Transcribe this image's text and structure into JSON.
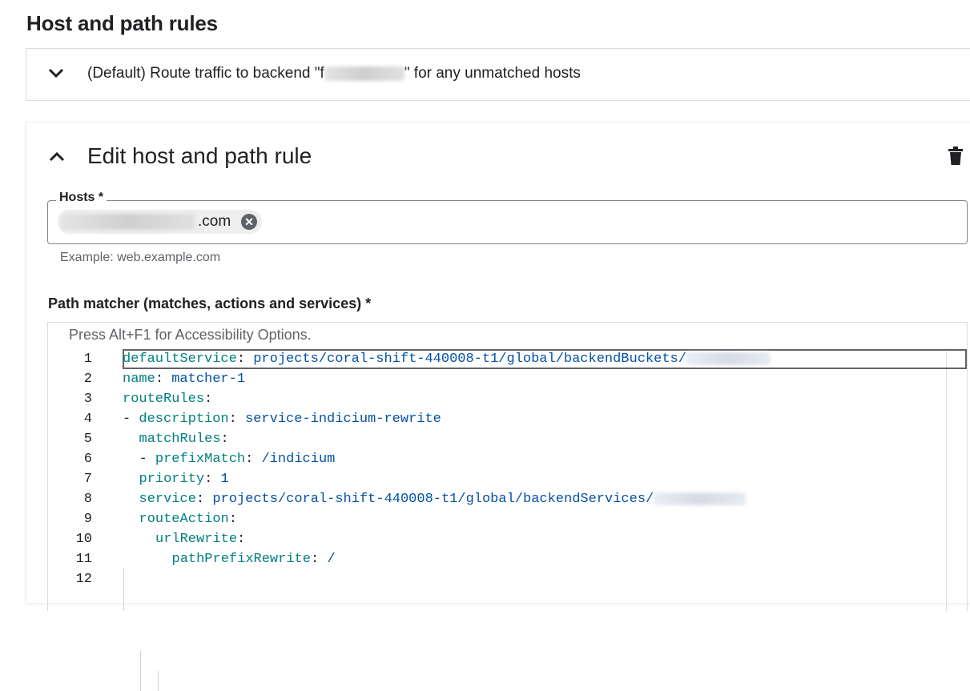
{
  "page": {
    "title": "Host and path rules"
  },
  "default_rule": {
    "text_before": "(Default) Route traffic to backend \"",
    "redacted_initial": "f",
    "text_after": "\" for any unmatched hosts",
    "icon": "chevron-down-icon"
  },
  "edit_rule": {
    "title": "Edit host and path rule",
    "collapse_icon": "chevron-up-icon",
    "delete_icon": "trash-icon"
  },
  "hosts": {
    "label": "Hosts *",
    "chip_suffix": ".com",
    "chip_remove_icon": "cancel-circle-icon",
    "hint": "Example: web.example.com"
  },
  "path_matcher": {
    "label": "Path matcher (matches, actions and services) *",
    "accessibility_hint": "Press Alt+F1 for Accessibility Options.",
    "lines": [
      {
        "n": "1",
        "key": "defaultService",
        "sep": ": ",
        "value": "projects/coral-shift-440008-t1/global/backendBuckets/"
      },
      {
        "n": "2",
        "key": "name",
        "sep": ": ",
        "value": "matcher-1"
      },
      {
        "n": "3",
        "key": "routeRules",
        "sep": ":",
        "value": ""
      },
      {
        "n": "4",
        "dash": "- ",
        "key": "description",
        "sep": ": ",
        "value": "service-indicium-rewrite"
      },
      {
        "n": "5",
        "key": "matchRules",
        "sep": ":",
        "value": ""
      },
      {
        "n": "6",
        "dash": "- ",
        "key": "prefixMatch",
        "sep": ": ",
        "value": "/indicium"
      },
      {
        "n": "7",
        "key": "priority",
        "sep": ": ",
        "value": "1"
      },
      {
        "n": "8",
        "key": "service",
        "sep": ": ",
        "value": "projects/coral-shift-440008-t1/global/backendServices/"
      },
      {
        "n": "9",
        "key": "routeAction",
        "sep": ":",
        "value": ""
      },
      {
        "n": "10",
        "key": "urlRewrite",
        "sep": ":",
        "value": ""
      },
      {
        "n": "11",
        "key": "pathPrefixRewrite",
        "sep": ": ",
        "value": "/"
      },
      {
        "n": "12",
        "key": "",
        "sep": "",
        "value": ""
      }
    ]
  },
  "colors": {
    "yaml_key": "#008080",
    "yaml_value": "#0451a5",
    "text": "#202124"
  }
}
